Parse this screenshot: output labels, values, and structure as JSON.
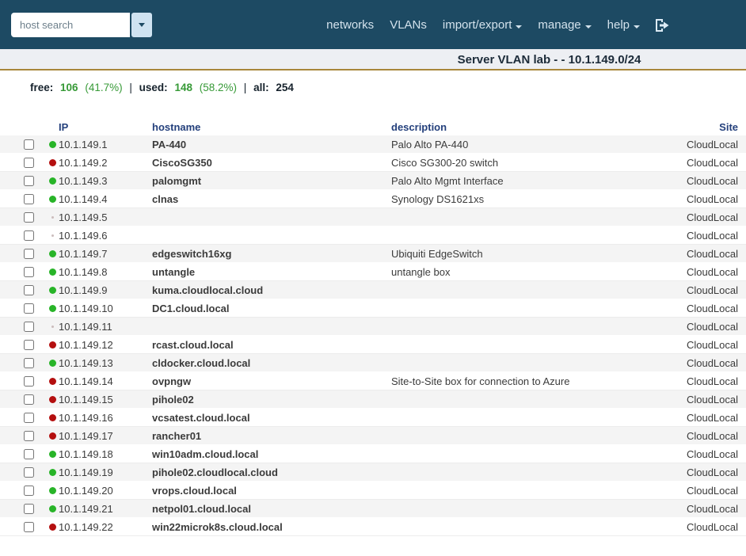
{
  "navbar": {
    "search_placeholder": "host search",
    "items": [
      {
        "label": "networks",
        "dropdown": false
      },
      {
        "label": "VLANs",
        "dropdown": false
      },
      {
        "label": "import/export",
        "dropdown": true
      },
      {
        "label": "manage",
        "dropdown": true
      },
      {
        "label": "help",
        "dropdown": true
      }
    ]
  },
  "subheader": {
    "title": "Server VLAN lab - - 10.1.149.0/24"
  },
  "stats": {
    "free_label": "free:",
    "free_value": "106",
    "free_pct": "(41.7%)",
    "sep1": "|",
    "used_label": "used:",
    "used_value": "148",
    "used_pct": "(58.2%)",
    "sep2": "|",
    "all_label": "all:",
    "all_value": "254"
  },
  "table": {
    "columns": {
      "ip": "IP",
      "hostname": "hostname",
      "description": "description",
      "site": "Site"
    },
    "rows": [
      {
        "status": "green",
        "ip": "10.1.149.1",
        "hostname": "PA-440",
        "description": "Palo Alto PA-440",
        "site": "CloudLocal"
      },
      {
        "status": "red",
        "ip": "10.1.149.2",
        "hostname": "CiscoSG350",
        "description": "Cisco SG300-20 switch",
        "site": "CloudLocal"
      },
      {
        "status": "green",
        "ip": "10.1.149.3",
        "hostname": "palomgmt",
        "description": "Palo Alto Mgmt Interface",
        "site": "CloudLocal"
      },
      {
        "status": "green",
        "ip": "10.1.149.4",
        "hostname": "clnas",
        "description": "Synology DS1621xs",
        "site": "CloudLocal"
      },
      {
        "status": "gray",
        "ip": "10.1.149.5",
        "hostname": "",
        "description": "",
        "site": "CloudLocal"
      },
      {
        "status": "gray",
        "ip": "10.1.149.6",
        "hostname": "",
        "description": "",
        "site": "CloudLocal"
      },
      {
        "status": "green",
        "ip": "10.1.149.7",
        "hostname": "edgeswitch16xg",
        "description": "Ubiquiti EdgeSwitch",
        "site": "CloudLocal"
      },
      {
        "status": "green",
        "ip": "10.1.149.8",
        "hostname": "untangle",
        "description": "untangle box",
        "site": "CloudLocal"
      },
      {
        "status": "green",
        "ip": "10.1.149.9",
        "hostname": "kuma.cloudlocal.cloud",
        "description": "",
        "site": "CloudLocal"
      },
      {
        "status": "green",
        "ip": "10.1.149.10",
        "hostname": "DC1.cloud.local",
        "description": "",
        "site": "CloudLocal"
      },
      {
        "status": "gray",
        "ip": "10.1.149.11",
        "hostname": "",
        "description": "",
        "site": "CloudLocal"
      },
      {
        "status": "red",
        "ip": "10.1.149.12",
        "hostname": "rcast.cloud.local",
        "description": "",
        "site": "CloudLocal"
      },
      {
        "status": "green",
        "ip": "10.1.149.13",
        "hostname": "cldocker.cloud.local",
        "description": "",
        "site": "CloudLocal"
      },
      {
        "status": "red",
        "ip": "10.1.149.14",
        "hostname": "ovpngw",
        "description": "Site-to-Site box for connection to Azure",
        "site": "CloudLocal"
      },
      {
        "status": "red",
        "ip": "10.1.149.15",
        "hostname": "pihole02",
        "description": "",
        "site": "CloudLocal"
      },
      {
        "status": "red",
        "ip": "10.1.149.16",
        "hostname": "vcsatest.cloud.local",
        "description": "",
        "site": "CloudLocal"
      },
      {
        "status": "red",
        "ip": "10.1.149.17",
        "hostname": "rancher01",
        "description": "",
        "site": "CloudLocal"
      },
      {
        "status": "green",
        "ip": "10.1.149.18",
        "hostname": "win10adm.cloud.local",
        "description": "",
        "site": "CloudLocal"
      },
      {
        "status": "green",
        "ip": "10.1.149.19",
        "hostname": "pihole02.cloudlocal.cloud",
        "description": "",
        "site": "CloudLocal"
      },
      {
        "status": "green",
        "ip": "10.1.149.20",
        "hostname": "vrops.cloud.local",
        "description": "",
        "site": "CloudLocal"
      },
      {
        "status": "green",
        "ip": "10.1.149.21",
        "hostname": "netpol01.cloud.local",
        "description": "",
        "site": "CloudLocal"
      },
      {
        "status": "red",
        "ip": "10.1.149.22",
        "hostname": "win22microk8s.cloud.local",
        "description": "",
        "site": "CloudLocal"
      }
    ]
  },
  "colors": {
    "navbar_bg": "#1d4a63",
    "subheader_bg": "#edeff3",
    "subheader_border": "#a8863a",
    "dot_green": "#28b428",
    "dot_red": "#b40f0f",
    "dot_gray": "#cbbcbc",
    "stats_green": "#379a37",
    "header_text": "#24407c"
  }
}
